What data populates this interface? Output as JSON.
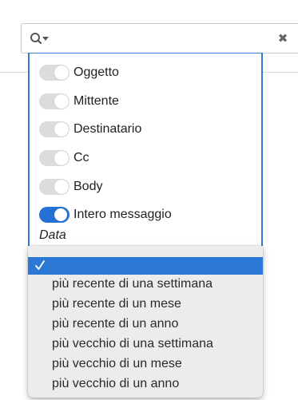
{
  "search": {
    "placeholder": "",
    "clear_symbol": "✖"
  },
  "filters": {
    "items": [
      {
        "label": "Oggetto",
        "enabled": false
      },
      {
        "label": "Mittente",
        "enabled": false
      },
      {
        "label": "Destinatario",
        "enabled": false
      },
      {
        "label": "Cc",
        "enabled": false
      },
      {
        "label": "Body",
        "enabled": false
      },
      {
        "label": "Intero messaggio",
        "enabled": true
      }
    ],
    "date_label": "Data"
  },
  "date_dropdown": {
    "selected": "",
    "options": [
      "più recente di una settimana",
      "più recente di un mese",
      "più recente di un anno",
      "più vecchio di una settimana",
      "più vecchio di un mese",
      "più vecchio di un anno"
    ]
  },
  "colors": {
    "accent": "#2f7bd6",
    "toggle_on": "#2572d4",
    "toggle_off": "#dcdcdc",
    "dropdown_bg": "#ececec",
    "dropdown_highlight": "#2c79d5"
  },
  "icons": {
    "search": "search-icon",
    "dropdown_arrow": "caret-down-icon",
    "clear": "close-icon",
    "check": "check-icon"
  }
}
